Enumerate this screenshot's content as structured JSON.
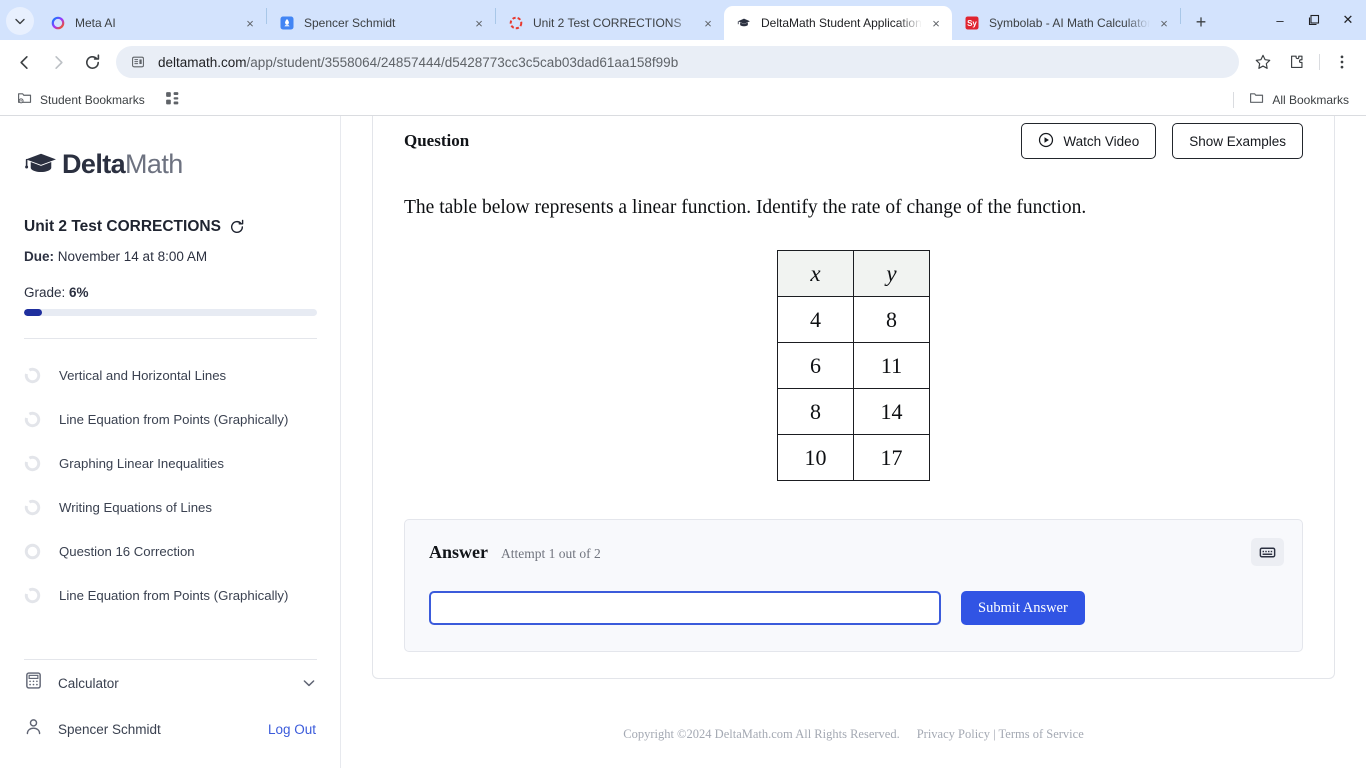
{
  "browser": {
    "tabs": [
      {
        "title": "Meta AI",
        "favicon": "meta-ai-icon",
        "active": false
      },
      {
        "title": "Spencer Schmidt",
        "favicon": "rocket-icon",
        "active": false
      },
      {
        "title": "Unit 2 Test CORRECTIONS",
        "favicon": "loading-spinner-icon",
        "active": false
      },
      {
        "title": "DeltaMath Student Application",
        "favicon": "graduation-cap-icon",
        "active": true
      },
      {
        "title": "Symbolab - AI Math Calculator",
        "favicon": "symbolab-icon",
        "active": false
      }
    ],
    "new_tab_label": "+",
    "close_label": "×",
    "window_controls": {
      "minimize": "–",
      "maximize": "❐",
      "close": "✕"
    },
    "nav": {
      "back": "back-arrow",
      "forward": "forward-arrow",
      "reload": "reload"
    },
    "address": {
      "host": "deltamath.com",
      "path": "/app/student/3558064/24857444/d5428773cc3c5cab03dad61aa158f99b",
      "full": "deltamath.com/app/student/3558064/24857444/d5428773cc3c5cab03dad61aa158f99b"
    },
    "toolbar_icons": [
      "bookmark-star-icon",
      "extensions-icon",
      "menu-icon"
    ],
    "bookmarks": {
      "items": [
        {
          "label": "Student Bookmarks",
          "icon": "folder-gear-icon"
        },
        {
          "label": "",
          "icon": "apps-grid-icon"
        }
      ],
      "all_bookmarks_label": "All Bookmarks"
    }
  },
  "sidebar": {
    "logo": {
      "bold": "Delta",
      "light": "Math",
      "icon": "graduation-cap-icon"
    },
    "assignment_title": "Unit 2 Test CORRECTIONS",
    "refresh_icon": "refresh-icon",
    "due_label": "Due:",
    "due_value": "November 14 at 8:00 AM",
    "grade_label": "Grade:",
    "grade_value": "6%",
    "grade_percent": 6,
    "topics": [
      {
        "label": "Vertical and Horizontal Lines",
        "icon": "progress-ring-icon"
      },
      {
        "label": "Line Equation from Points (Graphically)",
        "icon": "progress-ring-icon"
      },
      {
        "label": "Graphing Linear Inequalities",
        "icon": "progress-ring-icon"
      },
      {
        "label": "Writing Equations of Lines",
        "icon": "progress-ring-icon"
      },
      {
        "label": "Question 16 Correction",
        "icon": "progress-ring-icon"
      },
      {
        "label": "Line Equation from Points (Graphically)",
        "icon": "progress-ring-icon"
      }
    ],
    "calculator_label": "Calculator",
    "calculator_icon": "calculator-icon",
    "calculator_chevron": "chevron-down-icon",
    "user_name": "Spencer Schmidt",
    "user_icon": "person-icon",
    "logout_label": "Log Out"
  },
  "main": {
    "question_heading": "Question",
    "watch_video_label": "Watch Video",
    "watch_video_icon": "play-circle-icon",
    "show_examples_label": "Show Examples",
    "question_text": "The table below represents a linear function. Identify the rate of change of the function.",
    "answer_heading": "Answer",
    "attempt_text": "Attempt 1 out of 2",
    "keyboard_icon": "keyboard-icon",
    "answer_value": "",
    "answer_placeholder": "",
    "submit_label": "Submit Answer"
  },
  "chart_data": {
    "type": "table",
    "title": "The table below represents a linear function. Identify the rate of change of the function.",
    "columns": [
      "x",
      "y"
    ],
    "rows": [
      [
        "4",
        "8"
      ],
      [
        "6",
        "11"
      ],
      [
        "8",
        "14"
      ],
      [
        "10",
        "17"
      ]
    ],
    "x": [
      4,
      6,
      8,
      10
    ],
    "y": [
      8,
      11,
      14,
      17
    ]
  },
  "footer": {
    "copyright": "Copyright ©2024 DeltaMath.com All Rights Reserved.",
    "privacy": "Privacy Policy",
    "separator": "|",
    "terms": "Terms of Service"
  },
  "colors": {
    "accent_blue": "#3154e4",
    "progress_blue": "#1f2f9e",
    "tabstrip": "#d3e3fd",
    "link": "#3b5bdb"
  }
}
